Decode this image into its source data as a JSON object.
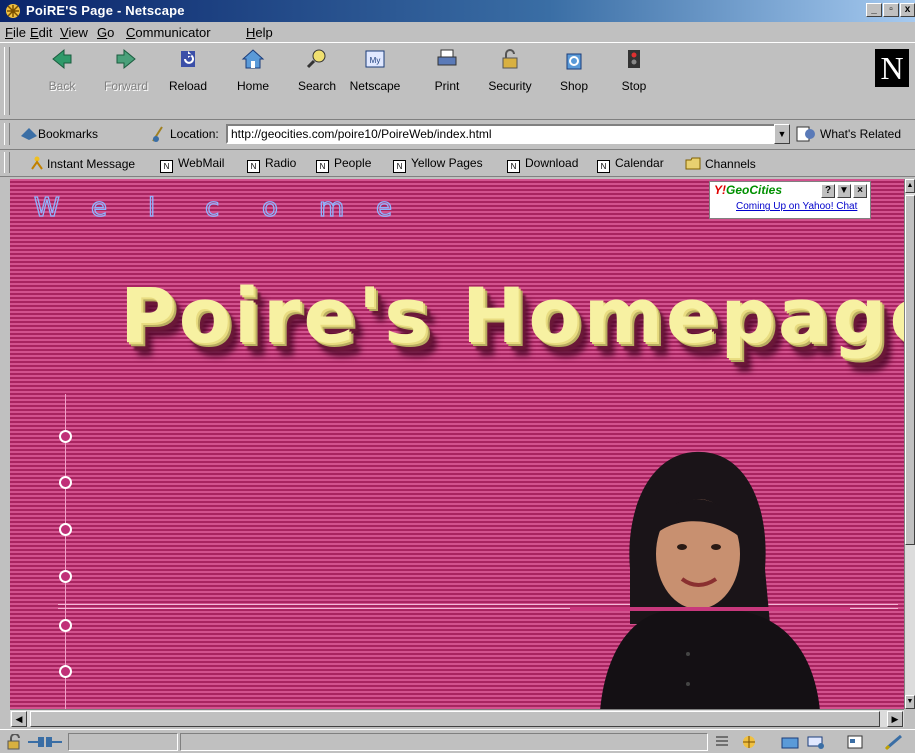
{
  "window": {
    "title": "PoiRE'S Page - Netscape",
    "controls": [
      "_",
      "▫",
      "x"
    ]
  },
  "menu": {
    "items": [
      {
        "key": "F",
        "rest": "ile"
      },
      {
        "key": "E",
        "rest": "dit"
      },
      {
        "key": "V",
        "rest": "iew"
      },
      {
        "key": "G",
        "rest": "o"
      },
      {
        "key": "C",
        "rest": "ommunicator"
      },
      {
        "key": "H",
        "rest": "elp"
      }
    ]
  },
  "navigation": {
    "buttons": [
      {
        "label": "Back",
        "icon": "back-arrow-icon",
        "enabled": false
      },
      {
        "label": "Forward",
        "icon": "forward-arrow-icon",
        "enabled": false
      },
      {
        "label": "Reload",
        "icon": "reload-icon",
        "enabled": true
      },
      {
        "label": "Home",
        "icon": "home-icon",
        "enabled": true
      },
      {
        "label": "Search",
        "icon": "search-icon",
        "enabled": true
      },
      {
        "label": "Netscape",
        "icon": "my-netscape-icon",
        "enabled": true
      },
      {
        "label": "Print",
        "icon": "printer-icon",
        "enabled": true
      },
      {
        "label": "Security",
        "icon": "lock-icon",
        "enabled": true
      },
      {
        "label": "Shop",
        "icon": "shopping-bag-icon",
        "enabled": true
      },
      {
        "label": "Stop",
        "icon": "stop-icon",
        "enabled": true
      }
    ],
    "logo": "N"
  },
  "location": {
    "bookmarks_label": "Bookmarks",
    "location_label": "Location:",
    "url": "http://geocities.com/poire10/PoireWeb/index.html",
    "whats_related": "What's Related"
  },
  "personal_toolbar": {
    "items": [
      {
        "label": "Instant Message",
        "icon": "instant-message-icon"
      },
      {
        "label": "WebMail",
        "icon": "bookmark-page-icon"
      },
      {
        "label": "Radio",
        "icon": "bookmark-page-icon"
      },
      {
        "label": "People",
        "icon": "bookmark-page-icon"
      },
      {
        "label": "Yellow Pages",
        "icon": "bookmark-page-icon"
      },
      {
        "label": "Download",
        "icon": "bookmark-page-icon"
      },
      {
        "label": "Calendar",
        "icon": "bookmark-page-icon"
      },
      {
        "label": "Channels",
        "icon": "channels-folder-icon"
      }
    ]
  },
  "page": {
    "welcome_letters": [
      "W",
      "e",
      "l",
      "c",
      "o",
      "m",
      "e"
    ],
    "headline": "Poire's Homepage",
    "geocities": {
      "brand_y": "Y!",
      "brand_name": "GeoCities",
      "buttons": [
        "?",
        "▼",
        "×"
      ],
      "link": "Coming Up on Yahoo! Chat"
    },
    "bead_count": 6
  },
  "colors": {
    "page_background": "#c8387c",
    "headline": "#f7f1a2",
    "welcome_outline": "#8fb4ff",
    "titlebar": "#0a246a"
  }
}
